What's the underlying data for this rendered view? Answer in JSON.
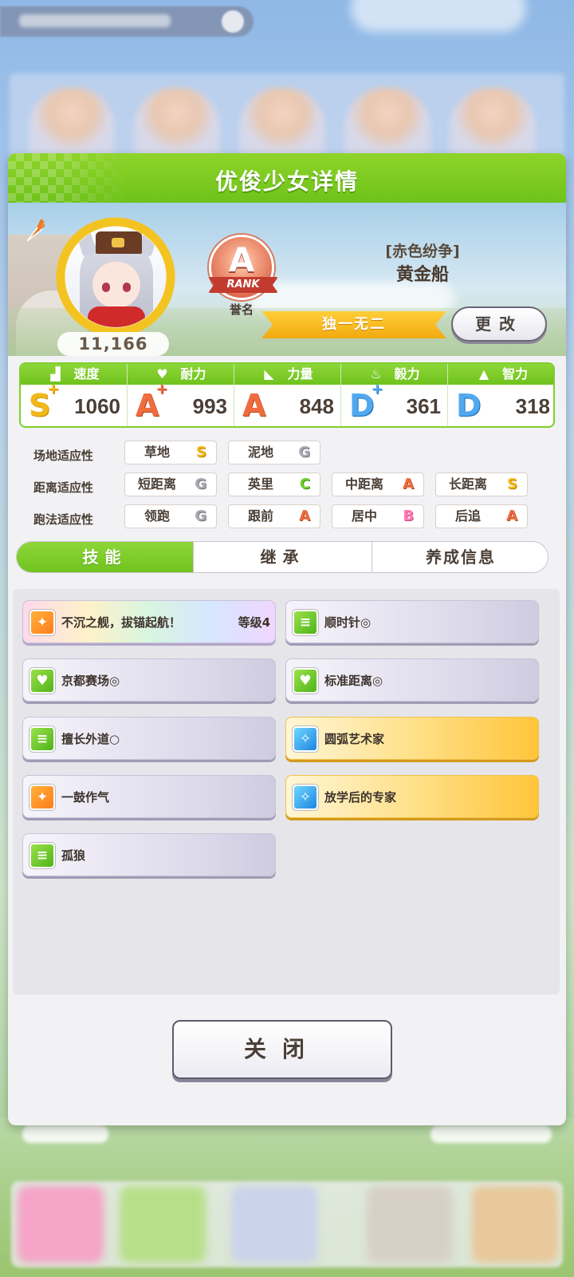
{
  "dialog": {
    "title": "优俊少女详情"
  },
  "profile": {
    "fans": "11,166",
    "rank_letter": "A",
    "rank_ribbon": "RANK",
    "rank_caption": "誉名",
    "epithet": "[赤色纷争]",
    "name": "黄金船",
    "title_ribbon": "独一无二",
    "change_label": "更改"
  },
  "stats": [
    {
      "label": "速度",
      "icon": "shoe-icon",
      "grade": "S",
      "plus": "+",
      "value": "1060"
    },
    {
      "label": "耐力",
      "icon": "heart-icon",
      "grade": "A",
      "plus": "+",
      "value": "993"
    },
    {
      "label": "力量",
      "icon": "muscle-icon",
      "grade": "A",
      "plus": "",
      "value": "848"
    },
    {
      "label": "毅力",
      "icon": "flame-icon",
      "grade": "D",
      "plus": "+",
      "value": "361"
    },
    {
      "label": "智力",
      "icon": "graduation-cap-icon",
      "grade": "D",
      "plus": "",
      "value": "318"
    }
  ],
  "aptitude": {
    "track": {
      "label": "场地适应性",
      "items": [
        {
          "name": "草地",
          "grade": "S"
        },
        {
          "name": "泥地",
          "grade": "G"
        }
      ]
    },
    "distance": {
      "label": "距离适应性",
      "items": [
        {
          "name": "短距离",
          "grade": "G"
        },
        {
          "name": "英里",
          "grade": "C"
        },
        {
          "name": "中距离",
          "grade": "A"
        },
        {
          "name": "长距离",
          "grade": "S"
        }
      ]
    },
    "style": {
      "label": "跑法适应性",
      "items": [
        {
          "name": "领跑",
          "grade": "G"
        },
        {
          "name": "跟前",
          "grade": "A"
        },
        {
          "name": "居中",
          "grade": "B"
        },
        {
          "name": "后追",
          "grade": "A"
        }
      ]
    }
  },
  "tabs": [
    {
      "label": "技能",
      "active": true
    },
    {
      "label": "继承",
      "active": false
    },
    {
      "label": "养成信息",
      "active": false
    }
  ],
  "skills": [
    {
      "name": "不沉之舰，拔锚起航！",
      "level": "等级4",
      "icon": "runner-icon",
      "style": "rainbow"
    },
    {
      "name": "顺时针◎",
      "icon": "card-icon",
      "style": "normal"
    },
    {
      "name": "京都赛场◎",
      "icon": "heart-icon",
      "style": "normal"
    },
    {
      "name": "标准距离◎",
      "icon": "heart-icon",
      "style": "normal"
    },
    {
      "name": "擅长外道○",
      "icon": "card-icon",
      "style": "normal"
    },
    {
      "name": "圆弧艺术家",
      "icon": "sparkle-icon",
      "style": "gold"
    },
    {
      "name": "一鼓作气",
      "icon": "runner-icon",
      "style": "normal"
    },
    {
      "name": "放学后的专家",
      "icon": "sparkle-icon",
      "style": "gold"
    },
    {
      "name": "孤狼",
      "icon": "card-icon",
      "style": "normal"
    }
  ],
  "close_label": "关闭",
  "colors": {
    "header_green": "#7cc922",
    "gold": "#f3b320",
    "grade_A": "#ef6c3f",
    "grade_S": "#f2b81a",
    "grade_D": "#52a8ee"
  }
}
